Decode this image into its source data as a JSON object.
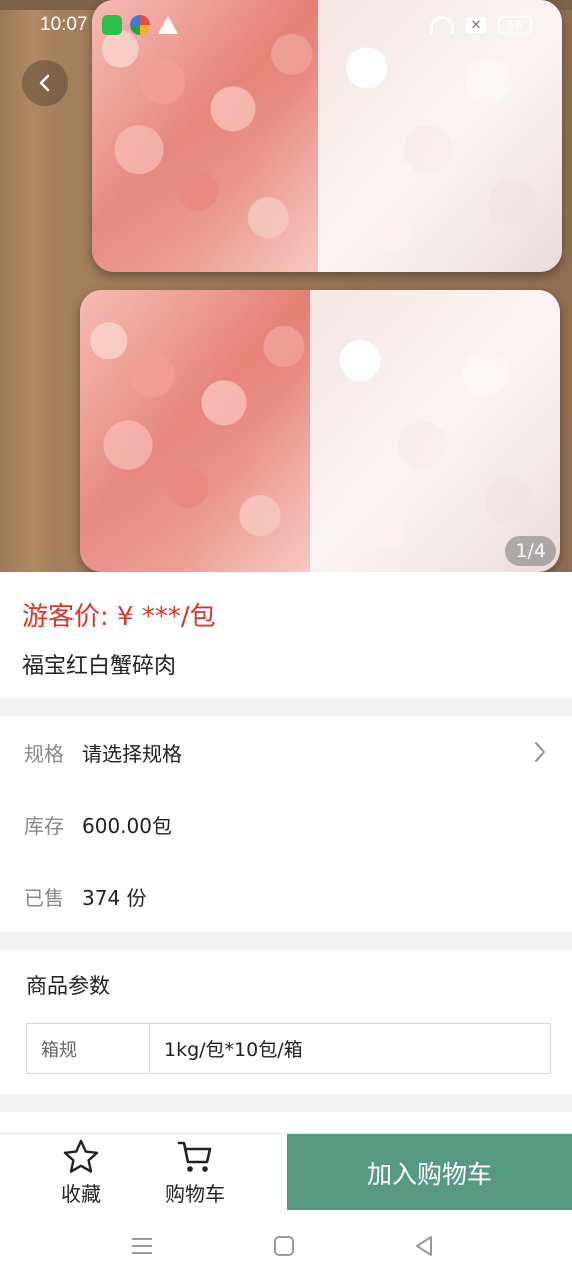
{
  "status_bar": {
    "time": "10:07",
    "battery": "56",
    "icons": [
      "wechat-icon",
      "app-multicolor-icon",
      "warning-icon",
      "wifi-icon",
      "sim-off-icon",
      "battery-icon"
    ]
  },
  "gallery": {
    "pager": "1/4"
  },
  "product": {
    "price": "游客价: ¥ ***/包",
    "title": "福宝红白蟹碎肉"
  },
  "specs": {
    "spec_label": "规格",
    "spec_value": "请选择规格",
    "stock_label": "库存",
    "stock_value": "600.00包",
    "sold_label": "已售",
    "sold_value": "374 份"
  },
  "params": {
    "title": "商品参数",
    "rows": [
      {
        "key": "箱规",
        "value": "1kg/包*10包/箱"
      }
    ]
  },
  "bottom_bar": {
    "favorite_label": "收藏",
    "cart_label": "购物车",
    "add_to_cart_label": "加入购物车"
  },
  "colors": {
    "price_red": "#d8362e",
    "accent_green": "#579a81"
  }
}
